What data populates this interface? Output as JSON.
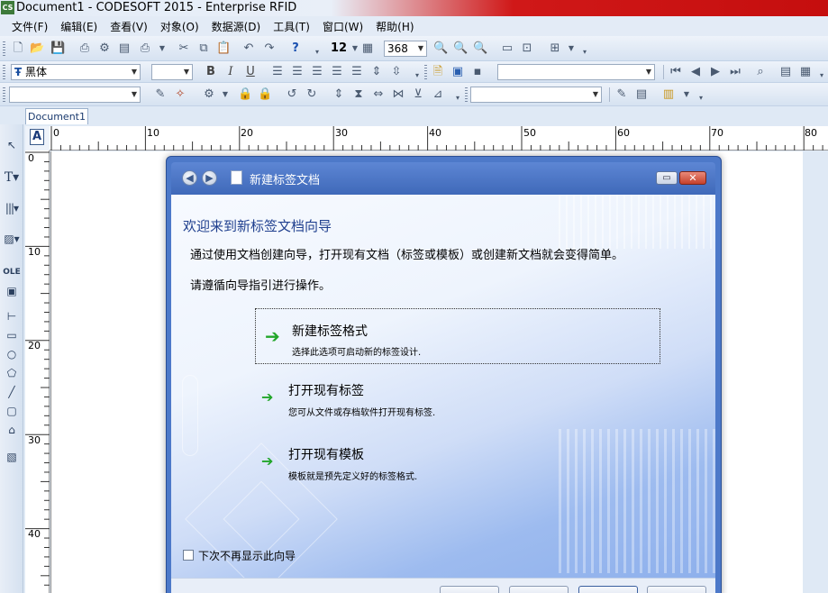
{
  "window": {
    "title": "Document1 - CODESOFT 2015 - Enterprise RFID",
    "app_icon": "CS"
  },
  "menu": [
    {
      "label": "文件(F)"
    },
    {
      "label": "编辑(E)"
    },
    {
      "label": "查看(V)"
    },
    {
      "label": "对象(O)"
    },
    {
      "label": "数据源(D)"
    },
    {
      "label": "工具(T)"
    },
    {
      "label": "窗口(W)"
    },
    {
      "label": "帮助(H)"
    }
  ],
  "toolbar": {
    "grid_size": "12",
    "zoom": "368",
    "font_name": "黑体",
    "font_size": "",
    "bold": "B",
    "italic": "I",
    "underline": "U"
  },
  "tab": {
    "label": "Document1"
  },
  "ruler": {
    "h_ticks": [
      "0",
      "10",
      "20",
      "30",
      "40",
      "50",
      "60",
      "70",
      "80"
    ],
    "v_ticks": [
      "0",
      "10",
      "20",
      "30",
      "40"
    ]
  },
  "dialog": {
    "title": "新建标签文档",
    "welcome": "欢迎来到新标签文档向导",
    "desc1": "通过使用文档创建向导，打开现有文档（标签或模板）或创建新文档就会变得简单。",
    "desc2": "请遵循向导指引进行操作。",
    "options": [
      {
        "title": "新建标签格式",
        "subtitle": "选择此选项可启动新的标签设计."
      },
      {
        "title": "打开现有标签",
        "subtitle": "您可从文件或存档软件打开现有标签."
      },
      {
        "title": "打开现有模板",
        "subtitle": "模板就是预先定义好的标签格式."
      }
    ],
    "dont_show_label": "下次不再显示此向导",
    "dont_show_checked": false
  },
  "icons": {
    "back": "back-arrow-icon",
    "forward": "forward-arrow-icon",
    "option_arrow": "green-arrow-icon"
  },
  "colors": {
    "title_gradient_end": "#c50e0e",
    "dialog_header": "#3f69b9",
    "welcome_text": "#1f3f8e",
    "arrow": "#22a62a"
  }
}
